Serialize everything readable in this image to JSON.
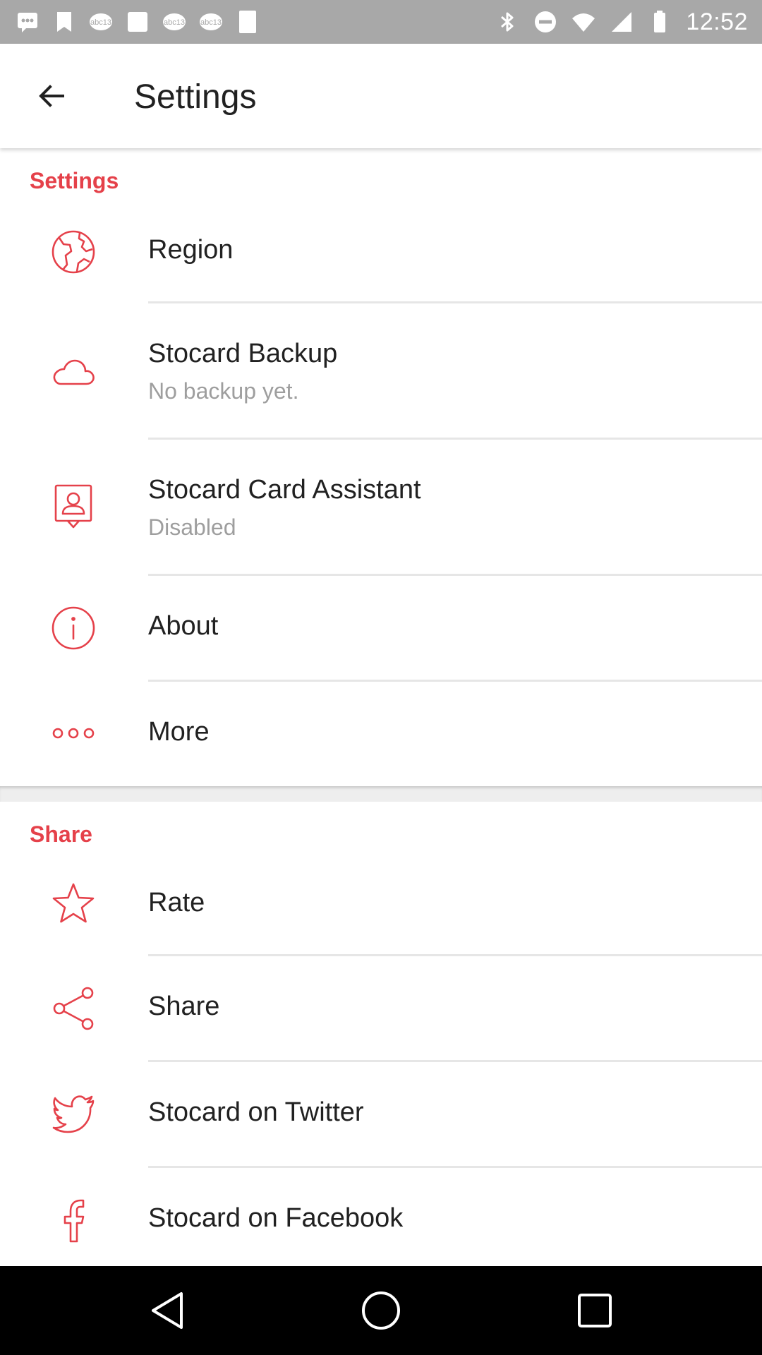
{
  "status_bar": {
    "time": "12:52",
    "left_icons": [
      "notification-icon",
      "bookmark-icon",
      "abc13-icon",
      "square-icon",
      "abc13-icon",
      "abc13-icon",
      "square-icon"
    ],
    "right_icons": [
      "bluetooth-icon",
      "do-not-disturb-icon",
      "wifi-icon",
      "signal-icon",
      "battery-icon"
    ]
  },
  "app_bar": {
    "back_icon": "arrow-back-icon",
    "title": "Settings"
  },
  "sections": {
    "settings": {
      "header": "Settings",
      "items": [
        {
          "icon": "globe-icon",
          "title": "Region",
          "subtitle": ""
        },
        {
          "icon": "cloud-icon",
          "title": "Stocard Backup",
          "subtitle": "No backup yet."
        },
        {
          "icon": "card-assistant-icon",
          "title": "Stocard Card Assistant",
          "subtitle": "Disabled"
        },
        {
          "icon": "info-icon",
          "title": "About",
          "subtitle": ""
        },
        {
          "icon": "more-icon",
          "title": "More",
          "subtitle": ""
        }
      ]
    },
    "share": {
      "header": "Share",
      "items": [
        {
          "icon": "star-icon",
          "title": "Rate"
        },
        {
          "icon": "share-icon",
          "title": "Share"
        },
        {
          "icon": "twitter-icon",
          "title": "Stocard on Twitter"
        },
        {
          "icon": "facebook-icon",
          "title": "Stocard on Facebook"
        }
      ]
    }
  },
  "nav_bar": {
    "buttons": [
      "back-triangle-icon",
      "home-circle-icon",
      "recents-square-icon"
    ]
  },
  "colors": {
    "accent": "#e5414a",
    "status_bar": "#a8a8a8",
    "nav_bar": "#000000",
    "text_primary": "#212121",
    "text_secondary": "#9e9e9e"
  }
}
